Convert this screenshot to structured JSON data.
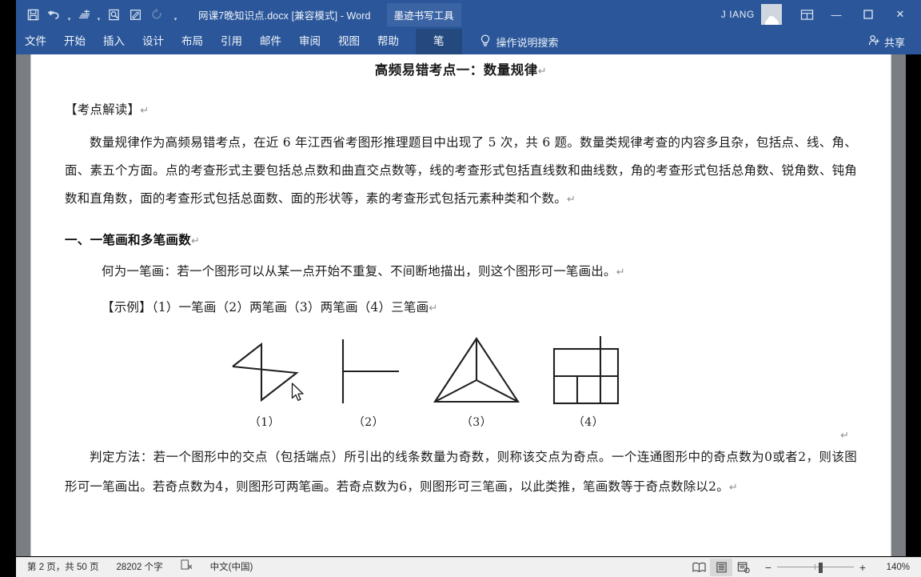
{
  "window": {
    "title": "网课7晚知识点.docx [兼容模式]  -  Word",
    "ink_tool_tab": "墨迹书写工具",
    "account_name": "J IANG",
    "minimize_glyph": "—",
    "maximize_glyph": "❐",
    "close_glyph": "✕"
  },
  "quick_access": [
    {
      "name": "save-icon",
      "label": "保存"
    },
    {
      "name": "undo-icon",
      "label": "撤消"
    },
    {
      "name": "redo-icon",
      "label": "恢复"
    },
    {
      "name": "print-preview-icon",
      "label": "打印预览和打印"
    },
    {
      "name": "edit-icon",
      "label": "编辑"
    },
    {
      "name": "repeat-icon",
      "label": "重复"
    },
    {
      "name": "customize-qat-icon",
      "label": "自定义快速访问工具栏"
    }
  ],
  "ribbon": {
    "tabs": [
      {
        "label": "文件",
        "active": false
      },
      {
        "label": "开始",
        "active": false
      },
      {
        "label": "插入",
        "active": false
      },
      {
        "label": "设计",
        "active": false
      },
      {
        "label": "布局",
        "active": false
      },
      {
        "label": "引用",
        "active": false
      },
      {
        "label": "邮件",
        "active": false
      },
      {
        "label": "审阅",
        "active": false
      },
      {
        "label": "视图",
        "active": false
      },
      {
        "label": "帮助",
        "active": false
      }
    ],
    "pen_tab": "笔",
    "tell_me": "操作说明搜索",
    "share": "共享"
  },
  "document": {
    "title": "高频易错考点一：数量规律",
    "pilcrow": "↵",
    "section_label": "【考点解读】",
    "intro_paragraph": "数量规律作为高频易错考点，在近 6 年江西省考图形推理题目中出现了 5 次，共 6 题。数量类规律考查的内容多且杂，包括点、线、角、面、素五个方面。点的考查形式主要包括总点数和曲直交点数等，线的考查形式包括直线数和曲线数，角的考查形式包括总角数、锐角数、钝角数和直角数，面的考查形式包括总面数、面的形状等，素的考查形式包括元素种类和个数。",
    "heading_one": "一、一笔画和多笔画数",
    "definition": "何为一笔画：若一个图形可以从某一点开始不重复、不间断地描出，则这个图形可一笔画出。",
    "example_line": "【示例】（1）一笔画（2）两笔画（3）两笔画（4）三笔画",
    "figures": [
      {
        "caption": "（1）",
        "shape": "pinwheel-z"
      },
      {
        "caption": "（2）",
        "shape": "tee-line"
      },
      {
        "caption": "（3）",
        "shape": "triangle-with-center"
      },
      {
        "caption": "（4）",
        "shape": "grid-with-stem"
      }
    ],
    "method_paragraph": "判定方法：若一个图形中的交点（包括端点）所引出的线条数量为奇数，则称该交点为奇点。一个连通图形中的奇点数为0或者2，则该图形可一笔画出。若奇点数为4，则图形可两笔画。若奇点数为6，则图形可三笔画，以此类推，笔画数等于奇点数除以2。"
  },
  "statusbar": {
    "page_info": "第 2 页，共 50 页",
    "word_count": "28202 个字",
    "proofing_icon": "proofing-errors-icon",
    "language": "中文(中国)",
    "views": [
      {
        "name": "read-mode-view",
        "label": "阅读视图",
        "active": false
      },
      {
        "name": "print-layout-view",
        "label": "页面视图",
        "active": true
      },
      {
        "name": "web-layout-view",
        "label": "Web 版式视图",
        "active": false
      }
    ],
    "zoom_out": "−",
    "zoom_in": "+",
    "zoom_level": "140%"
  },
  "colors": {
    "word_blue": "#2b579a",
    "pen_tab_blue": "#24497f",
    "page_white": "#ffffff",
    "doc_backdrop": "#7a7d82",
    "statusbar": "#f0f0f0",
    "spell_error_red": "#e03a3a"
  }
}
